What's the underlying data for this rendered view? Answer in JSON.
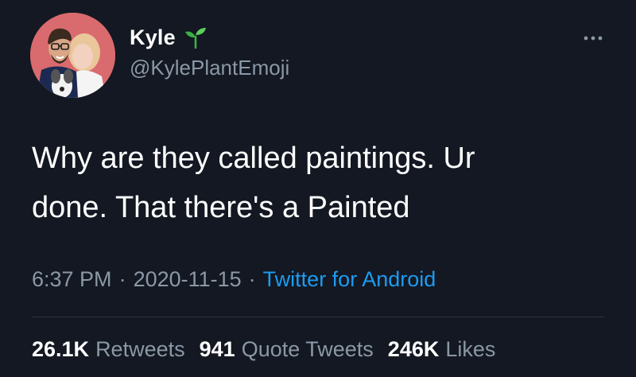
{
  "author": {
    "display_name": "Kyle",
    "handle": "@KylePlantEmoji",
    "name_emoji": "sprout-icon"
  },
  "tweet": {
    "text": "Why are they called paintings. Ur\ndone. That there's a Painted"
  },
  "meta": {
    "time": "6:37 PM",
    "date": "2020-11-15",
    "separator": "·",
    "source": "Twitter for Android"
  },
  "stats": {
    "retweets_count": "26.1K",
    "retweets_label": "Retweets",
    "quote_tweets_count": "941",
    "quote_tweets_label": "Quote Tweets",
    "likes_count": "246K",
    "likes_label": "Likes"
  },
  "colors": {
    "background": "#131822",
    "text_primary": "#ffffff",
    "text_secondary": "#8b98a5",
    "link": "#1d9bf0",
    "divider": "#2f3336",
    "avatar_bg": "#d96a6e"
  }
}
